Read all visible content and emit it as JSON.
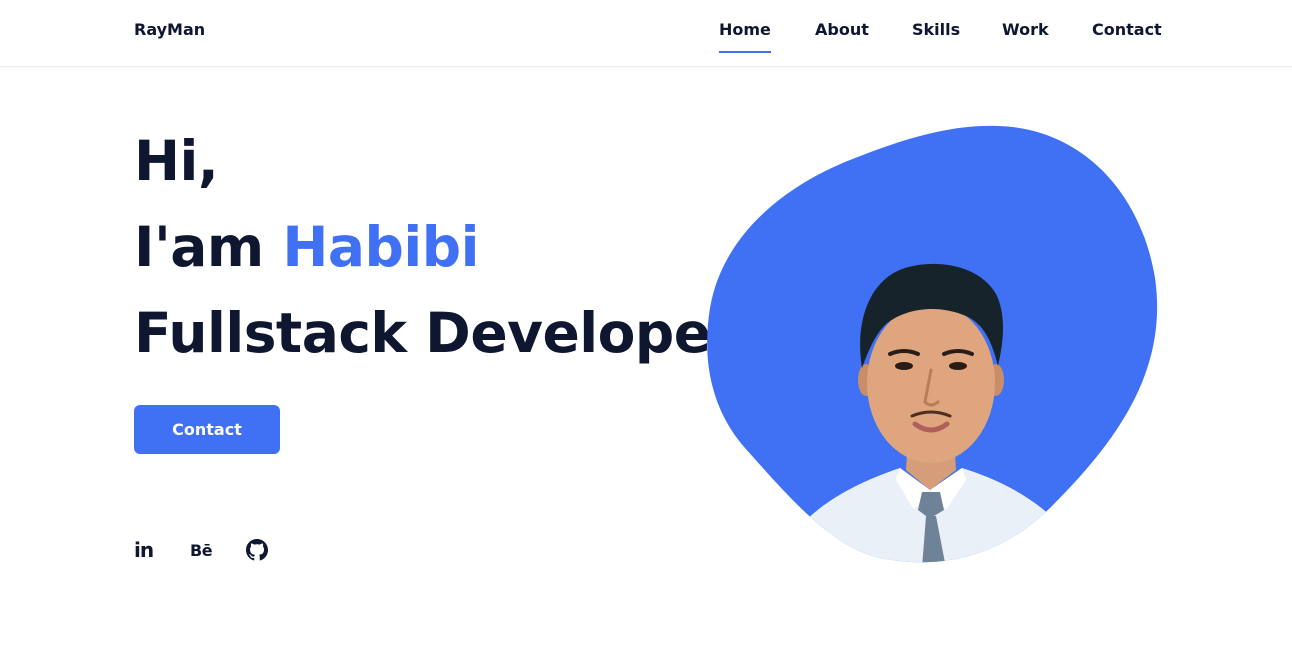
{
  "header": {
    "logo": "RayMan",
    "nav": [
      {
        "label": "Home",
        "active": true
      },
      {
        "label": "About",
        "active": false
      },
      {
        "label": "Skills",
        "active": false
      },
      {
        "label": "Work",
        "active": false
      },
      {
        "label": "Contact",
        "active": false
      }
    ]
  },
  "hero": {
    "line1": "Hi,",
    "line2_prefix": "I'am ",
    "line2_name": "Habibi",
    "line3": "Fullstack Developer",
    "button_label": "Contact"
  },
  "socials": [
    {
      "name": "linkedin-icon",
      "glyph": "in"
    },
    {
      "name": "behance-icon",
      "glyph": "Bē"
    },
    {
      "name": "github-icon",
      "glyph": ""
    }
  ],
  "colors": {
    "accent": "#4070f4",
    "text": "#0e1630",
    "background": "#ffffff"
  }
}
